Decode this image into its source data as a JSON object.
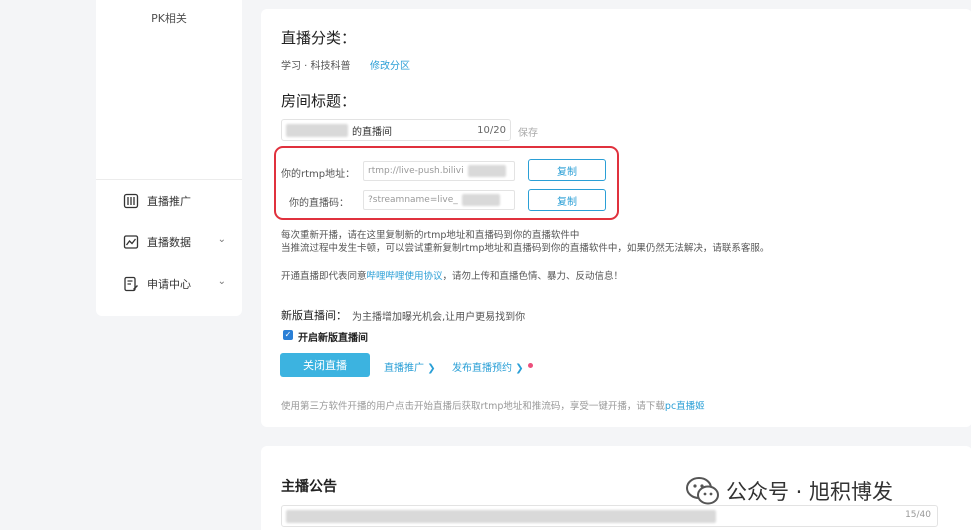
{
  "sidebar": {
    "pk_label": "PK相关",
    "items": [
      {
        "label": "直播推广",
        "icon": "promotion-icon",
        "has_chevron": false
      },
      {
        "label": "直播数据",
        "icon": "chart-icon",
        "has_chevron": true
      },
      {
        "label": "申请中心",
        "icon": "apply-icon",
        "has_chevron": true
      }
    ],
    "chevron": "⌄"
  },
  "category": {
    "heading": "直播分类：",
    "value": "学习 · 科技科普",
    "edit_link": "修改分区"
  },
  "room_title": {
    "heading": "房间标题：",
    "value_suffix": "的直播间",
    "counter": "10/20",
    "save": "保存"
  },
  "rtmp": {
    "address_label": "你的rtmp地址：",
    "address_value": "rtmp://live-push.bilivi",
    "code_label": "你的直播码：",
    "code_value": "?streamname=live_",
    "copy_label": "复制"
  },
  "notes": {
    "line1": "每次重新开播，请在这里复制新的rtmp地址和直播码到你的直播软件中",
    "line2": "当推流过程中发生卡顿，可以尝试重新复制rtmp地址和直播码到你的直播软件中，如果仍然无法解决，请联系客服。",
    "agreement_prefix": "开通直播即代表同意",
    "agreement_link": "哔哩哔哩使用协议",
    "agreement_suffix": "，请勿上传和直播色情、暴力、反动信息！"
  },
  "new_room": {
    "heading": "新版直播间：",
    "description": "为主播增加曝光机会,让用户更易找到你",
    "checkbox_label": "开启新版直播间",
    "checked": true
  },
  "actions": {
    "close_button": "关闭直播",
    "promote_link": "直播推广",
    "schedule_link": "发布直播预约",
    "arrow": "❯"
  },
  "footer_note": {
    "text": "使用第三方软件开播的用户点击开始直播后获取rtmp地址和推流码，享受一键开播，请下载",
    "link": "pc直播姬"
  },
  "announcement": {
    "heading": "主播公告",
    "counter": "15/40"
  },
  "watermark": {
    "text": "公众号 · 旭积博发"
  },
  "colors": {
    "accent": "#2a9fd6",
    "button": "#3cb3e0",
    "highlight_border": "#e0313d",
    "dot": "#ec4f7b"
  }
}
